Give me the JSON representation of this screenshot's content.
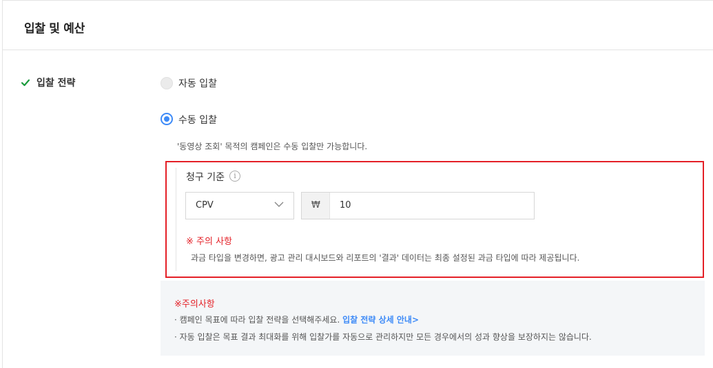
{
  "header": {
    "title": "입찰 및 예산"
  },
  "bid_strategy": {
    "label": "입찰 전략",
    "options": [
      {
        "label": "자동 입찰",
        "selected": false
      },
      {
        "label": "수동 입찰",
        "selected": true
      }
    ],
    "note": "'동영상 조회' 목적의 캠페인은 수동 입찰만 가능합니다."
  },
  "billing": {
    "label": "청구 기준",
    "type_value": "CPV",
    "currency": "₩",
    "amount": "10",
    "warning_title": "※ 주의 사항",
    "warning_text": "과금 타입을 변경하면, 광고 관리 대시보드와 리포트의 '결과' 데이터는 최종 설정된 과금 타입에 따라 제공됩니다."
  },
  "notice": {
    "title": "※주의사항",
    "line1_prefix": "· 캠페인 목표에 따라 입찰 전략을 선택해주세요. ",
    "line1_link": "입찰 전략 상세 안내",
    "line1_link_arrow": ">",
    "line2": "· 자동 입찰은 목표 결과 최대화를 위해 입찰가를 자동으로 관리하지만 모든 경우에서의 성과 향상을 보장하지는 않습니다."
  },
  "colors": {
    "accent": "#3d8af7",
    "warning": "#e41f26",
    "check": "#1a9b3c"
  }
}
